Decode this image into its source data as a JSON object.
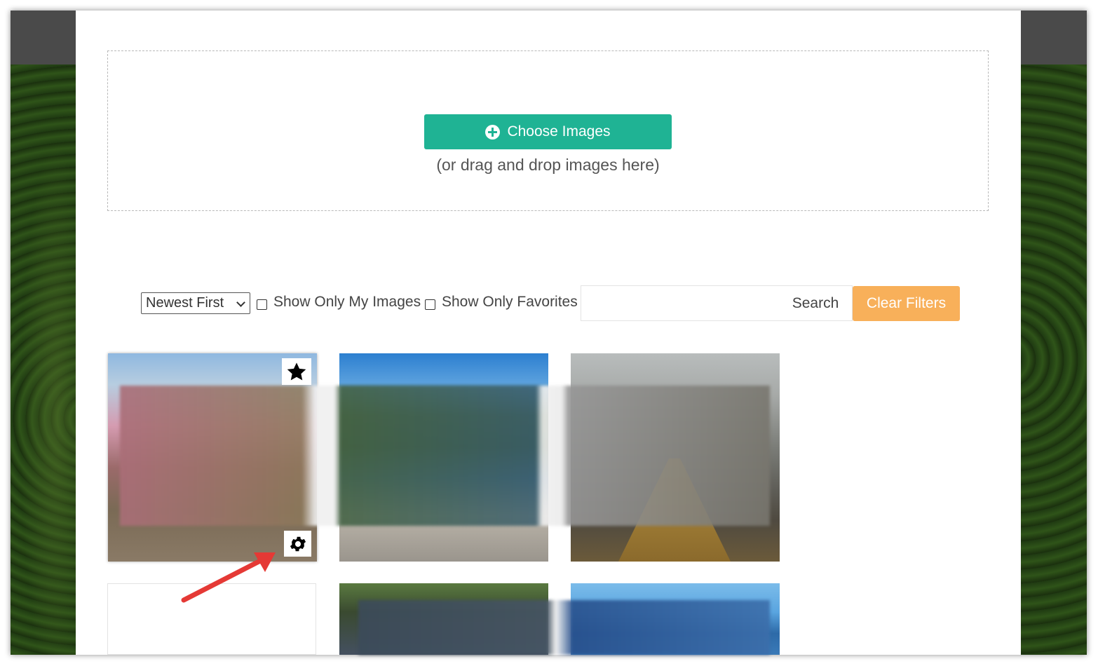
{
  "upload": {
    "choose_label": "Choose Images",
    "drag_hint": "(or drag and drop images here)"
  },
  "filters": {
    "sort_value": "Newest First",
    "show_only_my_images": "Show Only My Images",
    "show_only_favorites": "Show Only Favorites",
    "search_placeholder": "",
    "search_label": "Search",
    "clear_label": "Clear Filters"
  },
  "gallery": {
    "thumbnails": [
      {
        "favorite": true,
        "settings": true
      },
      {
        "favorite": false,
        "settings": false
      },
      {
        "favorite": false,
        "settings": false
      },
      {
        "favorite": false,
        "settings": false
      },
      {
        "favorite": false,
        "settings": false
      },
      {
        "favorite": false,
        "settings": false
      }
    ]
  },
  "icons": {
    "add": "plus-circle-icon",
    "favorite": "star-icon",
    "settings": "gear-icon",
    "annotation": "red-arrow-icon"
  },
  "colors": {
    "primary": "#1fb394",
    "warning": "#f8b05a",
    "annotation": "#e53935"
  }
}
